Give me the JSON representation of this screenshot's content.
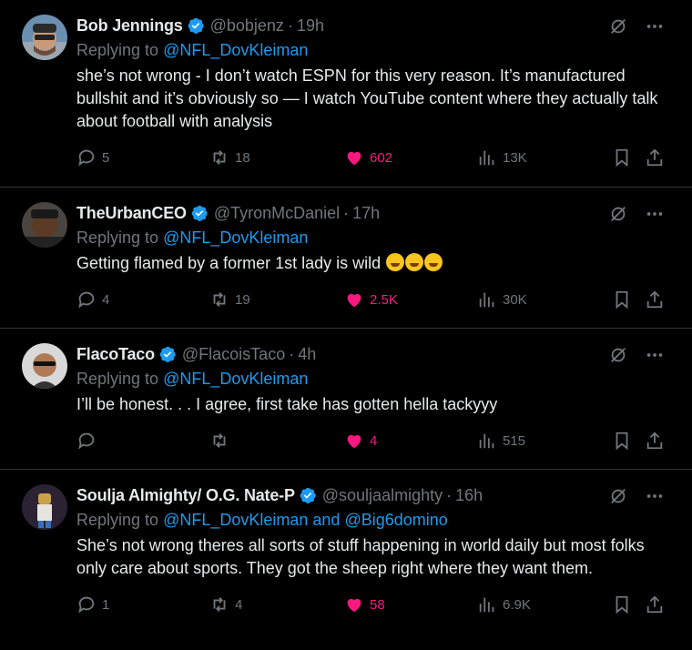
{
  "icons": {
    "verified_color": "#1d9bf0",
    "like_color": "#f91880",
    "grok": "slash-circle-icon",
    "more": "more-icon",
    "reply": "reply-icon",
    "retweet": "retweet-icon",
    "views": "views-icon",
    "bookmark": "bookmark-icon",
    "share": "share-icon"
  },
  "tweets": [
    {
      "name": "Bob Jennings",
      "handle": "@bobjenz",
      "dot": "·",
      "time": "19h",
      "replying_label": "Replying to",
      "mention": "@NFL_DovKleiman",
      "text": "she’s not wrong - I don’t watch ESPN for this very reason. It’s manufactured bullshit and it’s obviously so — I watch YouTube content where they actually talk about football with analysis",
      "replies": "5",
      "retweets": "18",
      "likes": "602",
      "views": "13K"
    },
    {
      "name": "TheUrbanCEO",
      "handle": "@TyronMcDaniel",
      "dot": "·",
      "time": "17h",
      "replying_label": "Replying to",
      "mention": "@NFL_DovKleiman",
      "text": "Getting flamed by a former 1st lady is wild ",
      "replies": "4",
      "retweets": "19",
      "likes": "2.5K",
      "views": "30K"
    },
    {
      "name": "FlacoTaco",
      "handle": "@FlacoisTaco",
      "dot": "·",
      "time": "4h",
      "replying_label": "Replying to",
      "mention": "@NFL_DovKleiman",
      "text": "I’ll be honest. . . I agree, first take has gotten hella tackyyy",
      "replies": "",
      "retweets": "",
      "likes": "4",
      "views": "515"
    },
    {
      "name": "Soulja Almighty/ O.G. Nate-P",
      "handle": "@souljaalmighty",
      "dot": "·",
      "time": "16h",
      "replying_label": "Replying to",
      "mention": "@NFL_DovKleiman and @Big6domino",
      "text": "She’s not wrong theres all sorts of stuff happening in world daily but most folks only care about sports. They got the sheep right where they want them.",
      "replies": "1",
      "retweets": "4",
      "likes": "58",
      "views": "6.9K"
    }
  ]
}
